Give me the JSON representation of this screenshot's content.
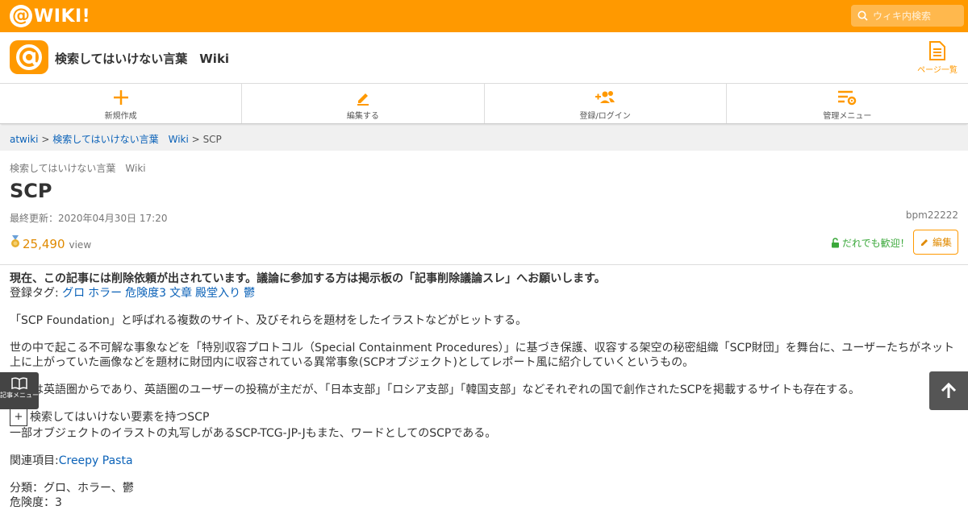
{
  "topbar": {
    "logo_text": "WIKI!",
    "search_placeholder": "ウィキ内検索"
  },
  "site": {
    "title": "検索してはいけない言葉　Wiki",
    "page_list_label": "ページ一覧"
  },
  "nav": [
    {
      "label": "新規作成",
      "icon": "plus-icon"
    },
    {
      "label": "編集する",
      "icon": "pencil-icon"
    },
    {
      "label": "登録/ログイン",
      "icon": "add-user-icon"
    },
    {
      "label": "管理メニュー",
      "icon": "settings-menu-icon"
    }
  ],
  "breadcrumb": {
    "home": "atwiki",
    "sep1": ">",
    "wiki": "検索してはいけない言葉　Wiki",
    "sep2": ">",
    "current": "SCP"
  },
  "page": {
    "wiki_name": "検索してはいけない言葉　Wiki",
    "title": "SCP",
    "last_updated": "最終更新：2020年04月30日 17:20",
    "author": "bpm22222",
    "view_count": "25,490",
    "view_label": "view",
    "welcome": "だれでも歓迎！",
    "edit_label": "編集"
  },
  "content": {
    "notice": "現在、この記事には削除依頼が出されています。議論に参加する方は掲示板の「記事削除議論スレ」へお願いします。",
    "tags_label": "登録タグ:",
    "tags": [
      "グロ",
      "ホラー",
      "危険度3",
      "文章",
      "殿堂入り",
      "鬱"
    ],
    "para1": "「SCP Foundation」と呼ばれる複数のサイト、及びそれらを題材をしたイラストなどがヒットする。",
    "para2": "世の中で起こる不可解な事象などを「特別収容プロトコル（Special Containment Procedures）」に基づき保護、収容する架空の秘密組織「SCP財団」を舞台に、ユーザーたちがネット上に上がっていた画像などを題材に財団内に収容されている異常事象(SCPオブジェクト)としてレポート風に紹介していくというもの。",
    "para3": "発祥は英語圏からであり、英語圏のユーザーの投稿が主だが、「日本支部」「ロシア支部」「韓国支部」などそれぞれの国で創作されたSCPを掲載するサイトも存在する。",
    "toggle_symbol": "+",
    "toggle_label": "検索してはいけない要素を持つSCP",
    "para4": "一部オブジェクトのイラストの丸写しがあるSCP-TCG-JP-Jもまた、ワードとしてのSCPである。",
    "related_label": "関連項目:",
    "related_link": "Creepy Pasta",
    "category": "分類：グロ、ホラー、鬱",
    "danger": "危険度：3"
  },
  "float_menu": {
    "label": "記事メニュー"
  },
  "colors": {
    "brand": "#ff9900",
    "link": "#0b62b8",
    "welcome": "#3aa83a"
  }
}
